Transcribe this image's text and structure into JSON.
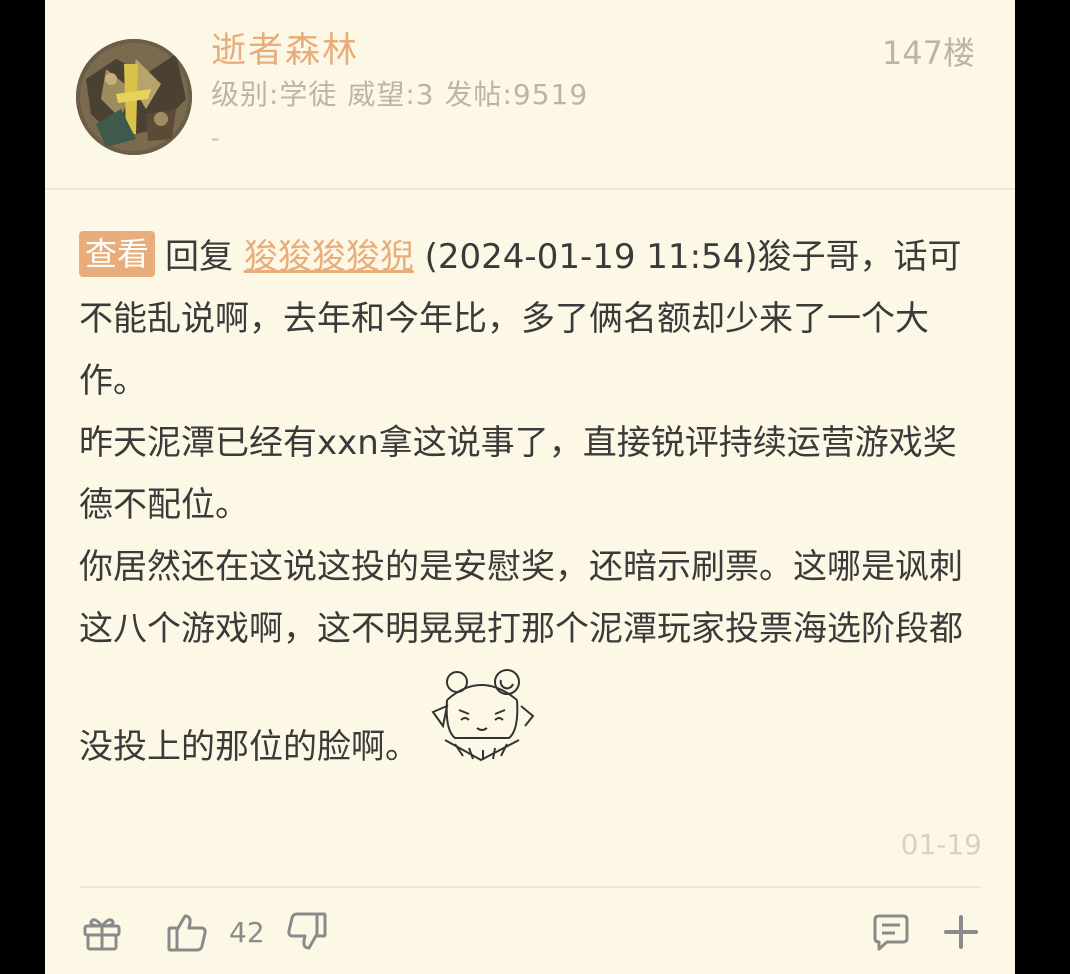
{
  "user": {
    "name": "逝者森林",
    "info": "级别:学徒 威望:3 发帖:9519",
    "signature": "-"
  },
  "post": {
    "floor": "147楼",
    "view_button": "查看",
    "reply_prefix": "回复",
    "reply_user": "狻狻狻狻猊",
    "reply_rest": " (2024-01-19 11:54)狻子哥，话可不能乱说啊，去年和今年比，多了俩名额却少来了一个大作。",
    "para2": "昨天泥潭已经有xxn拿这说事了，直接锐评持续运营游戏奖德不配位。",
    "para3": "你居然还在这说这投的是安慰奖，还暗示刷票。这哪是讽刺这八个游戏啊，这不明晃晃打那个泥潭玩家投票海选阶段都没投上的那位的脸啊。",
    "date": "01-19"
  },
  "actions": {
    "like_count": "42",
    "icons": [
      "gift-icon",
      "thumbs-up-icon",
      "thumbs-down-icon",
      "comment-icon",
      "plus-icon"
    ]
  },
  "colors": {
    "accent": "#e8ad7b",
    "background": "#fdf8e5",
    "text": "#3a3a3a",
    "muted": "#b9b5aa"
  }
}
